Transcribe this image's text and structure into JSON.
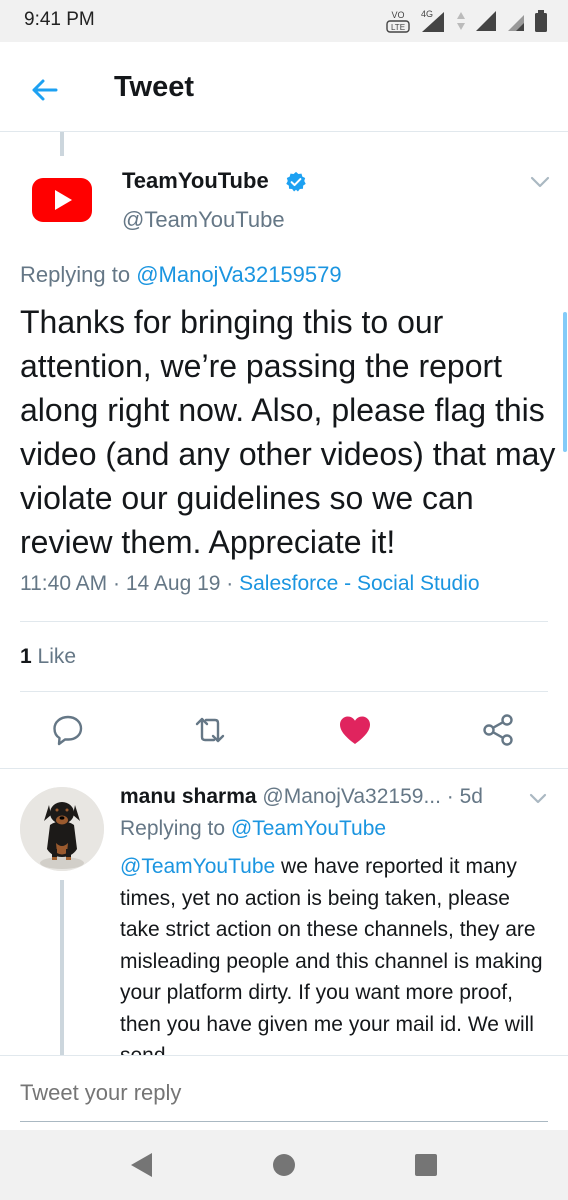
{
  "status_bar": {
    "time": "9:41 PM",
    "network_labels": [
      "VoLTE",
      "4G"
    ]
  },
  "app_bar": {
    "title": "Tweet"
  },
  "tweet": {
    "author_name": "TeamYouTube",
    "author_handle": "@TeamYouTube",
    "replying_prefix": "Replying to ",
    "replying_to": "@ManojVa32159579",
    "text": "Thanks for bringing this to our attention, we’re passing the report along right now. Also, please flag this video (and any other videos) that may violate our guidelines so we can review them. Appreciate it!",
    "time": "11:40 AM",
    "date": "14 Aug 19",
    "source": "Salesforce - Social Studio",
    "like_count": "1",
    "like_label": "Like",
    "liked_color": "#e0245e"
  },
  "reply": {
    "author_name": "manu sharma",
    "author_handle": "@ManojVa32159...",
    "age": "5d",
    "replying_prefix": "Replying to ",
    "replying_to": "@TeamYouTube",
    "mention": "@TeamYouTube",
    "text": " we have reported it many times, yet no action is being taken, please take strict action on these channels, they are misleading people and this channel is making your platform dirty. If you want more proof, then you have given me your mail id. We will send"
  },
  "compose": {
    "placeholder": "Tweet your reply"
  },
  "icons": {
    "back": "back-arrow-icon",
    "verified": "verified-badge-icon",
    "caret": "chevron-down-icon",
    "reply": "reply-icon",
    "retweet": "retweet-icon",
    "like": "heart-icon",
    "share": "share-icon"
  },
  "colors": {
    "accent": "#1b95e0",
    "youtube_red": "#ff0000",
    "muted": "#657786"
  }
}
